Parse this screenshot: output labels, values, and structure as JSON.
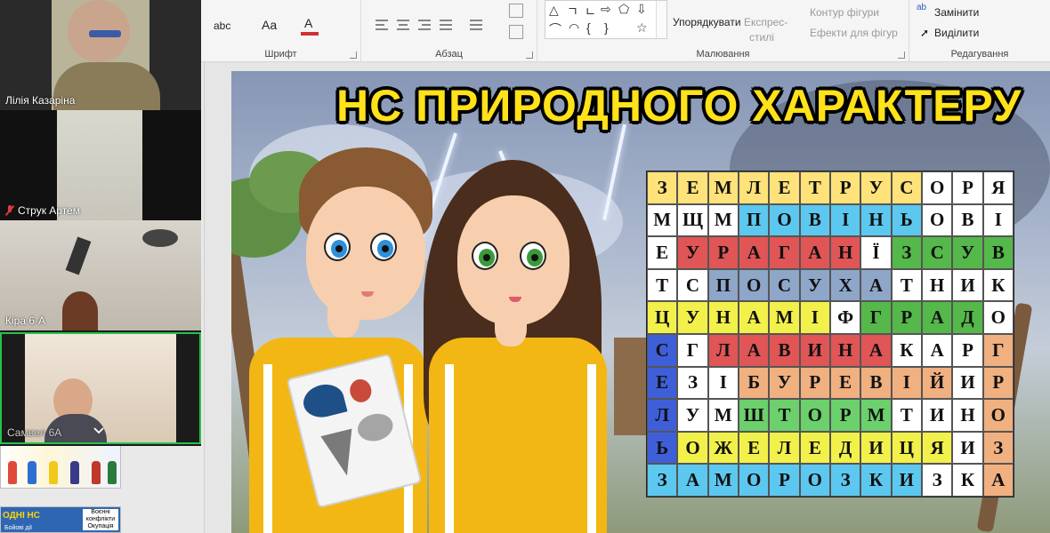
{
  "ribbon": {
    "font_group_label": "Шрифт",
    "paragraph_group_label": "Абзац",
    "drawing_group_label": "Малювання",
    "editing_group_label": "Редагування",
    "font_glyph_abc": "abc",
    "font_glyph_aa": "Aa",
    "font_glyph_a": "A",
    "arrange_label": "Упорядкувати",
    "quick_styles_label_1": "Експрес-",
    "quick_styles_label_2": "стилі",
    "shape_outline_label": "Контур фігури",
    "shape_effects_label": "Ефекти для фігур",
    "replace_label": "Замінити",
    "select_label": "Виділити",
    "replace_glyph": "ab"
  },
  "participants": [
    {
      "name": "Лілія Казаріна",
      "muted": false
    },
    {
      "name": "Струк Артем",
      "muted": true
    },
    {
      "name": "Кіра 6-А",
      "muted": false
    },
    {
      "name": "Самвел 6А",
      "muted": false
    }
  ],
  "thumbnails": {
    "slide2_title": "ОДНІ НС",
    "slide2_box_line1": "Воєнні",
    "slide2_box_line2": "конфлікти",
    "slide2_box_line3": "Окупація",
    "slide2_box_line4": "Бойові дії"
  },
  "slide": {
    "title": "НС ПРИРОДНОГО ХАРАКТЕРУ",
    "grid": [
      [
        "З",
        "Е",
        "М",
        "Л",
        "Е",
        "Т",
        "Р",
        "У",
        "С",
        "О",
        "Р",
        "Я"
      ],
      [
        "М",
        "Щ",
        "М",
        "П",
        "О",
        "В",
        "І",
        "Н",
        "Ь",
        "О",
        "В",
        "І"
      ],
      [
        "Е",
        "У",
        "Р",
        "А",
        "Г",
        "А",
        "Н",
        "Ї",
        "З",
        "С",
        "У",
        "В"
      ],
      [
        "Т",
        "С",
        "П",
        "О",
        "С",
        "У",
        "Х",
        "А",
        "Т",
        "Н",
        "И",
        "К"
      ],
      [
        "Ц",
        "У",
        "Н",
        "А",
        "М",
        "І",
        "Ф",
        "Г",
        "Р",
        "А",
        "Д",
        "О"
      ],
      [
        "С",
        "Г",
        "Л",
        "А",
        "В",
        "И",
        "Н",
        "А",
        "К",
        "А",
        "Р",
        "Г"
      ],
      [
        "Е",
        "З",
        "І",
        "Б",
        "У",
        "Р",
        "Е",
        "В",
        "І",
        "Й",
        "И",
        "Р"
      ],
      [
        "Л",
        "У",
        "М",
        "Ш",
        "Т",
        "О",
        "Р",
        "М",
        "Т",
        "И",
        "Н",
        "О"
      ],
      [
        "Ь",
        "О",
        "Ж",
        "Е",
        "Л",
        "Е",
        "Д",
        "И",
        "Ц",
        "Я",
        "И",
        "З"
      ],
      [
        "З",
        "А",
        "М",
        "О",
        "Р",
        "О",
        "З",
        "К",
        "И",
        "З",
        "К",
        "А"
      ]
    ],
    "grid_colors": [
      [
        "#ffe27a",
        "#ffe27a",
        "#ffe27a",
        "#ffe27a",
        "#ffe27a",
        "#ffe27a",
        "#ffe27a",
        "#ffe27a",
        "#ffe27a",
        "#ffffff",
        "#ffffff",
        "#ffffff"
      ],
      [
        "#ffffff",
        "#ffffff",
        "#ffffff",
        "#5cc8f0",
        "#5cc8f0",
        "#5cc8f0",
        "#5cc8f0",
        "#5cc8f0",
        "#5cc8f0",
        "#ffffff",
        "#ffffff",
        "#ffffff"
      ],
      [
        "#ffffff",
        "#e05555",
        "#e05555",
        "#e05555",
        "#e05555",
        "#e05555",
        "#e05555",
        "#ffffff",
        "#55b84a",
        "#55b84a",
        "#55b84a",
        "#55b84a"
      ],
      [
        "#ffffff",
        "#ffffff",
        "#8ea6c8",
        "#8ea6c8",
        "#8ea6c8",
        "#8ea6c8",
        "#8ea6c8",
        "#8ea6c8",
        "#ffffff",
        "#ffffff",
        "#ffffff",
        "#ffffff"
      ],
      [
        "#f2f04a",
        "#f2f04a",
        "#f2f04a",
        "#f2f04a",
        "#f2f04a",
        "#f2f04a",
        "#ffffff",
        "#55b84a",
        "#55b84a",
        "#55b84a",
        "#55b84a",
        "#ffffff"
      ],
      [
        "#3f5fd8",
        "#ffffff",
        "#e05555",
        "#e05555",
        "#e05555",
        "#e05555",
        "#e05555",
        "#e05555",
        "#ffffff",
        "#ffffff",
        "#ffffff",
        "#f0b080"
      ],
      [
        "#3f5fd8",
        "#ffffff",
        "#ffffff",
        "#f0b080",
        "#f0b080",
        "#f0b080",
        "#f0b080",
        "#f0b080",
        "#f0b080",
        "#f0b080",
        "#ffffff",
        "#f0b080"
      ],
      [
        "#3f5fd8",
        "#ffffff",
        "#ffffff",
        "#6cd06c",
        "#6cd06c",
        "#6cd06c",
        "#6cd06c",
        "#6cd06c",
        "#ffffff",
        "#ffffff",
        "#ffffff",
        "#f0b080"
      ],
      [
        "#3f5fd8",
        "#f2f04a",
        "#f2f04a",
        "#f2f04a",
        "#f2f04a",
        "#f2f04a",
        "#f2f04a",
        "#f2f04a",
        "#f2f04a",
        "#f2f04a",
        "#ffffff",
        "#f0b080"
      ],
      [
        "#5cc8f0",
        "#5cc8f0",
        "#5cc8f0",
        "#5cc8f0",
        "#5cc8f0",
        "#5cc8f0",
        "#5cc8f0",
        "#5cc8f0",
        "#5cc8f0",
        "#ffffff",
        "#ffffff",
        "#f0b080"
      ]
    ]
  }
}
